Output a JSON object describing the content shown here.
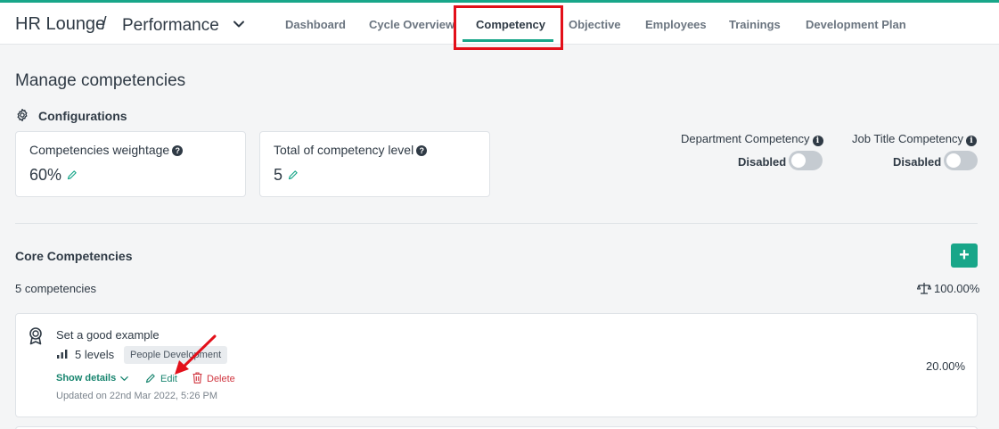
{
  "header": {
    "brand": "HR Lounge",
    "separator": "/",
    "module": "Performance",
    "tabs": [
      {
        "label": "Dashboard"
      },
      {
        "label": "Cycle Overview"
      },
      {
        "label": "Competency"
      },
      {
        "label": "Objective"
      },
      {
        "label": "Employees"
      },
      {
        "label": "Trainings"
      },
      {
        "label": "Development Plan"
      }
    ],
    "active_tab": "Competency",
    "accent_color": "#18a689",
    "highlight_color": "#e3101a"
  },
  "page": {
    "title": "Manage competencies",
    "config_label": "Configurations"
  },
  "config_cards": [
    {
      "label": "Competencies weightage",
      "value": "60%"
    },
    {
      "label": "Total of competency level",
      "value": "5"
    }
  ],
  "toggles": [
    {
      "label": "Department Competency",
      "state": "Disabled"
    },
    {
      "label": "Job Title Competency",
      "state": "Disabled"
    }
  ],
  "core": {
    "title": "Core Competencies",
    "add_label": "+",
    "count": "5 competencies",
    "total_weight": "100.00%"
  },
  "competencies": [
    {
      "name": "Set a good example",
      "levels": "5 levels",
      "tag": "People Development",
      "show_details": "Show details",
      "edit": "Edit",
      "delete": "Delete",
      "updated": "Updated on 22nd Mar 2022, 5:26 PM",
      "weight": "20.00%"
    }
  ]
}
